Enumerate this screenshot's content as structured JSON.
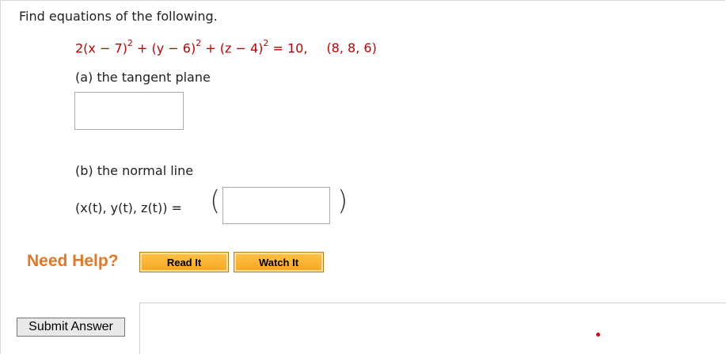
{
  "question": {
    "prompt": "Find equations of the following.",
    "equation": {
      "part1": "2(x − 7)",
      "exp1": "2",
      "part2": " + (y − 6)",
      "exp2": "2",
      "part3": " + (z − 4)",
      "exp3": "2",
      "part4": " = 10,",
      "point": "(8, 8, 6)"
    },
    "part_a_label": "(a) the tangent plane",
    "part_a_value": "",
    "part_b_label": "(b) the normal line",
    "parametric_label": "(x(t), y(t), z(t)) =",
    "open_paren": "(",
    "close_paren": ")",
    "part_b_value": ""
  },
  "help": {
    "label": "Need Help?",
    "read_button": "Read It",
    "watch_button": "Watch It"
  },
  "submit_label": "Submit Answer",
  "colors": {
    "equation_text": "#c00000",
    "need_help": "#e87722",
    "help_button": "#f5a623"
  }
}
